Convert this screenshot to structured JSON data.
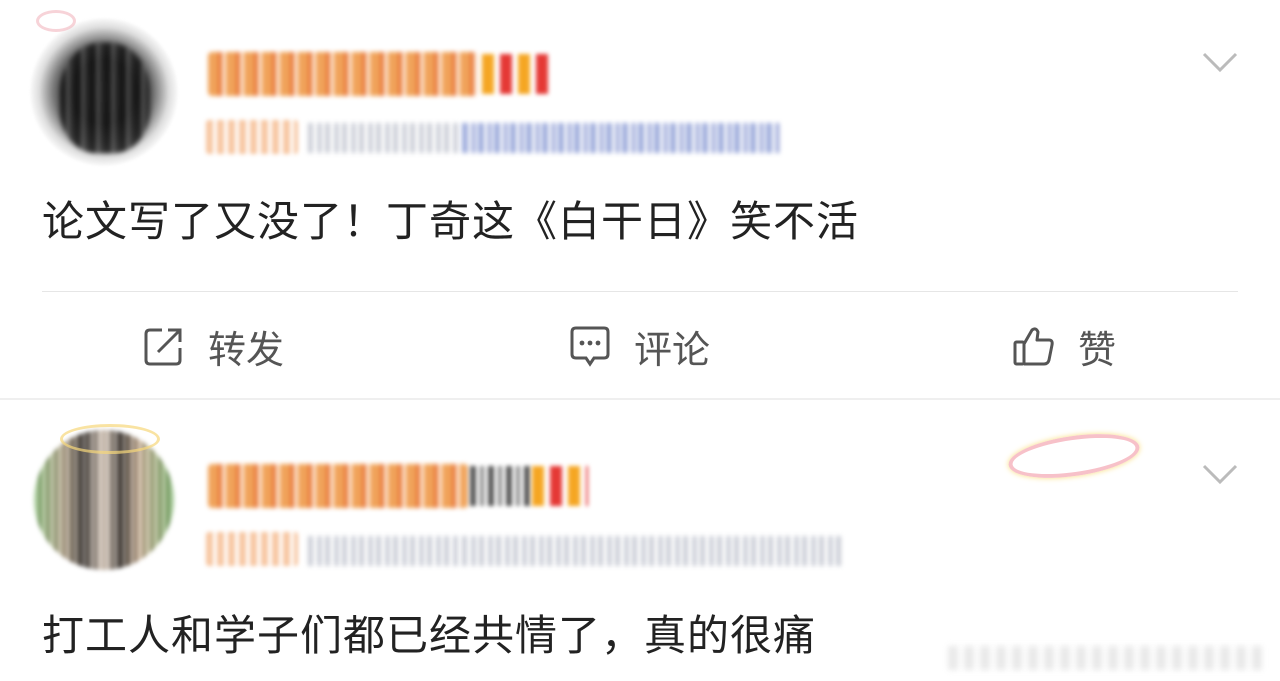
{
  "posts": [
    {
      "content": "论文写了又没了！丁奇这《白干日》笑不活",
      "actions": {
        "repost": "转发",
        "comment": "评论",
        "like": "赞"
      }
    },
    {
      "content": "打工人和学子们都已经共情了，真的很痛"
    }
  ],
  "icons": {
    "repost": "edit-square-icon",
    "comment": "comment-bubble-icon",
    "like": "thumbs-up-icon",
    "more": "chevron-down-icon"
  },
  "colors": {
    "action_text": "#555555",
    "content_text": "#222222",
    "divider": "#e6e6e6"
  }
}
